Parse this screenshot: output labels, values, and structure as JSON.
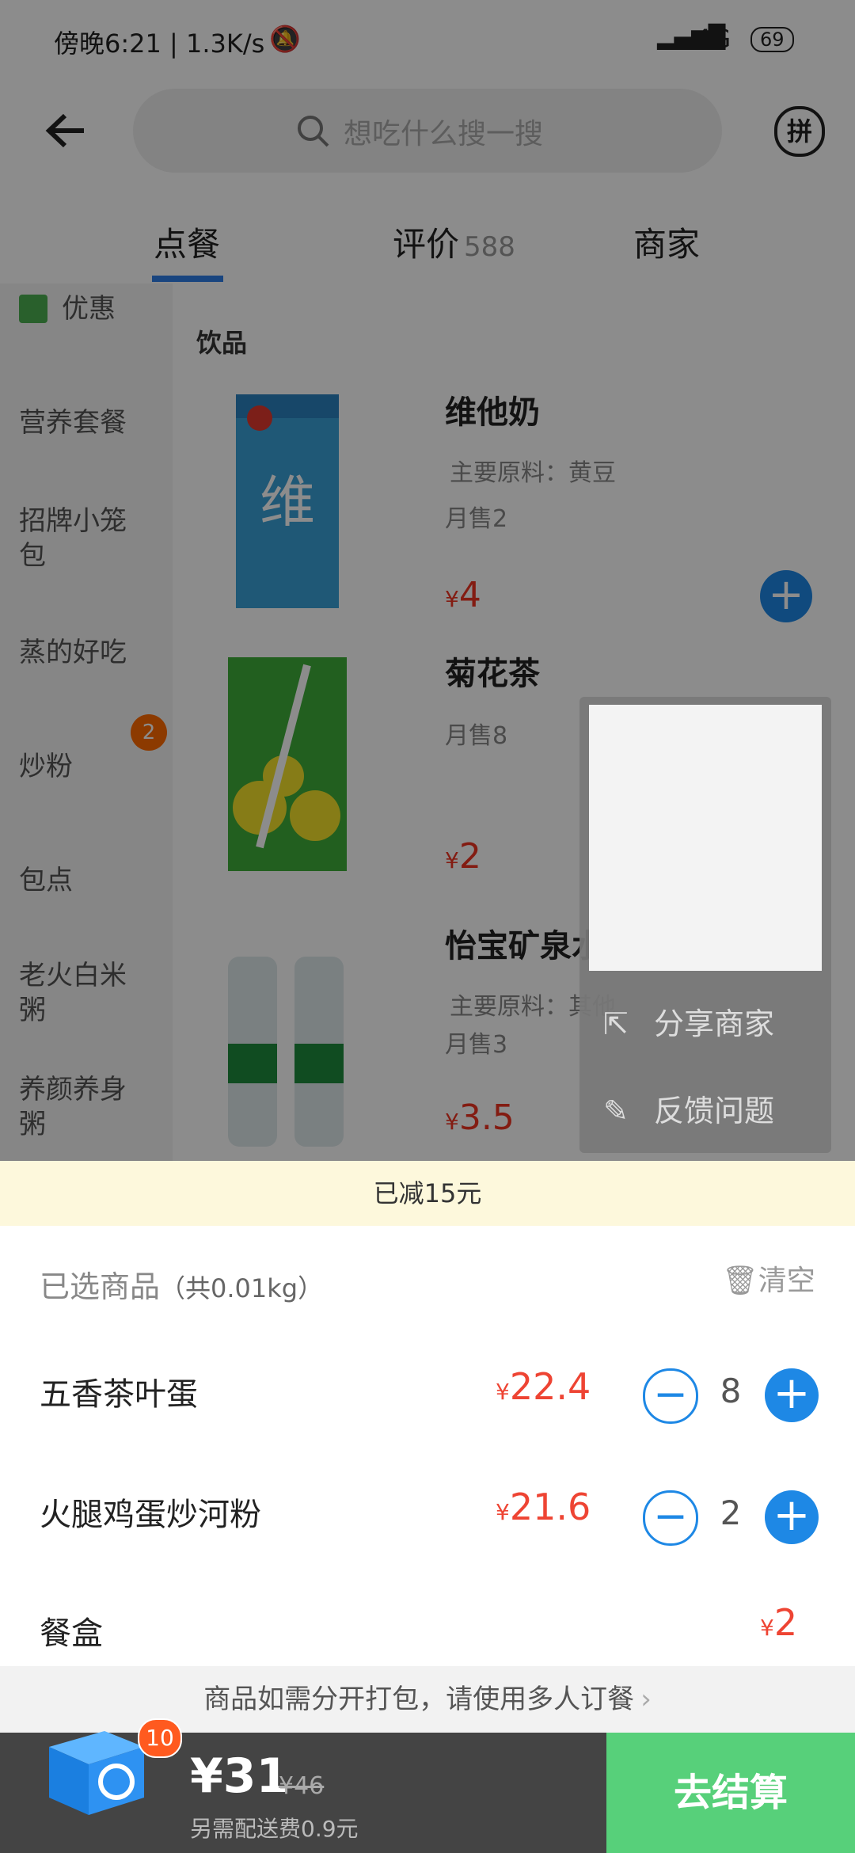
{
  "status_bar": {
    "time_speed": "傍晚6:21 | 1.3K/s",
    "network": "4G",
    "battery": "69"
  },
  "header": {
    "search_placeholder": "想吃什么搜一搜"
  },
  "tabs": [
    {
      "label": "点餐",
      "active": true
    },
    {
      "label": "评价",
      "count": "588"
    },
    {
      "label": "商家"
    }
  ],
  "sidebar": {
    "items": [
      "优惠",
      "营养套餐",
      "招牌小笼包",
      "蒸的好吃",
      "炒粉",
      "包点",
      "老火白米粥",
      "养颜养身粥"
    ],
    "badge": "2"
  },
  "menu": {
    "category": "饮品",
    "items": [
      {
        "name": "维他奶",
        "desc": "主要原料：黄豆",
        "sold": "月售2",
        "price": "4"
      },
      {
        "name": "菊花茶",
        "desc": "",
        "sold": "月售8",
        "price": "2"
      },
      {
        "name": "怡宝矿泉水",
        "desc": "主要原料：其他",
        "sold": "月售3",
        "price": "3.5"
      }
    ]
  },
  "popup": {
    "share": "分享商家",
    "feedback": "反馈问题"
  },
  "discount_banner": "已减15元",
  "cart": {
    "title": "已选商品",
    "weight": "（共0.01kg）",
    "clear": "清空",
    "items": [
      {
        "name": "五香茶叶蛋",
        "price": "22.4",
        "qty": "8"
      },
      {
        "name": "火腿鸡蛋炒河粉",
        "price": "21.6",
        "qty": "2"
      }
    ],
    "box_name": "餐盒",
    "box_price": "2",
    "currency": "¥"
  },
  "tip": "商品如需分开打包，请使用多人订餐",
  "bottom": {
    "badge": "10",
    "total": "¥31",
    "original": "¥46",
    "delivery": "另需配送费0.9元",
    "checkout": "去结算"
  },
  "colors": {
    "accent": "#1e88e5",
    "price": "#ee3322",
    "checkout": "#57d07a"
  }
}
